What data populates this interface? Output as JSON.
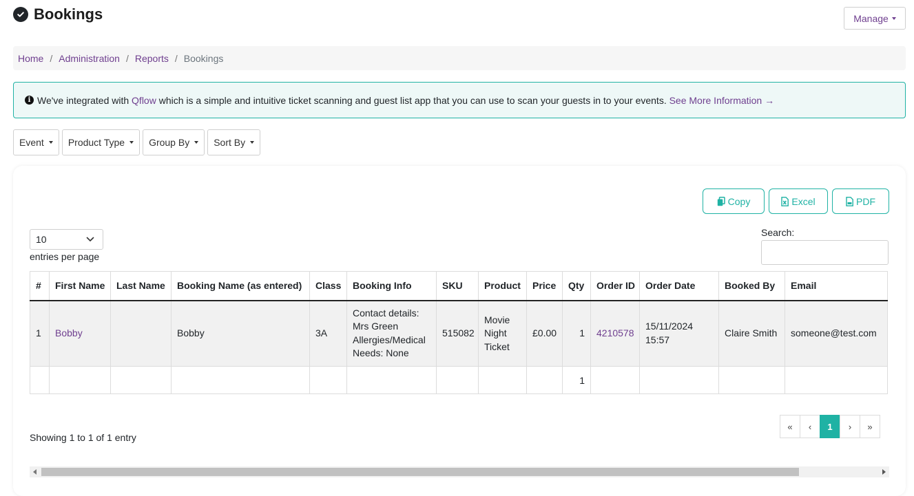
{
  "header": {
    "title": "Bookings",
    "manage_label": "Manage"
  },
  "breadcrumb": {
    "home": "Home",
    "administration": "Administration",
    "reports": "Reports",
    "current": "Bookings",
    "separator": "/"
  },
  "alert": {
    "text_before": "We've integrated with ",
    "link_qflow": "Qflow",
    "text_after": " which is a simple and intuitive ticket scanning and guest list app that you can use to scan your guests in to your events. ",
    "more_link": "See More Information →"
  },
  "filters": {
    "event": "Event",
    "product_type": "Product Type",
    "group_by": "Group By",
    "sort_by": "Sort By"
  },
  "export": {
    "copy": "Copy",
    "excel": "Excel",
    "pdf": "PDF"
  },
  "table_controls": {
    "page_length": "10",
    "entries_label": "entries per page",
    "search_label": "Search:",
    "search_value": ""
  },
  "table": {
    "headers": [
      "#",
      "First Name",
      "Last Name",
      "Booking Name (as entered)",
      "Class",
      "Booking Info",
      "SKU",
      "Product",
      "Price",
      "Qty",
      "Order ID",
      "Order Date",
      "Booked By",
      "Email"
    ],
    "rows": [
      {
        "index": "1",
        "first_name": "Bobby",
        "last_name": "",
        "booking_name": "Bobby",
        "class": "3A",
        "booking_info": [
          "Contact details:",
          "Mrs Green",
          "Allergies/Medical",
          "Needs: None"
        ],
        "sku": "515082",
        "product": [
          "Movie",
          "Night",
          "Ticket"
        ],
        "price": "£0.00",
        "qty": "1",
        "order_id": "4210578",
        "order_date": "15/11/2024 15:57",
        "booked_by": "Claire Smith",
        "email": "someone@test.com"
      }
    ],
    "totals": {
      "qty": "1"
    }
  },
  "footer": {
    "showing": "Showing 1 to 1 of 1 entry"
  },
  "pagination": {
    "first": "«",
    "prev": "‹",
    "current": "1",
    "next": "›",
    "last": "»"
  },
  "colors": {
    "accent": "#1fb2a4",
    "link": "#6f3f8f",
    "alert_bg": "#eef8f7"
  }
}
